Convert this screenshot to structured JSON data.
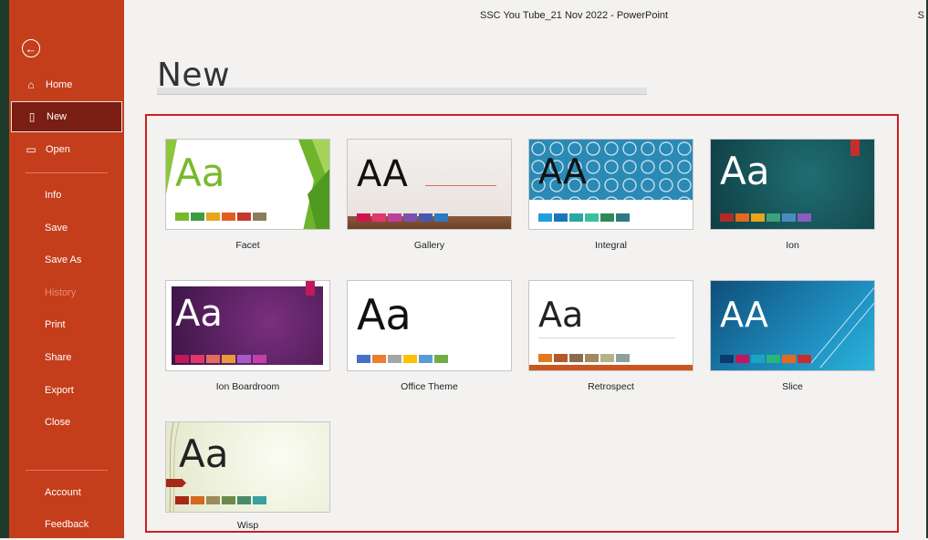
{
  "window": {
    "doc_title": "SSC You Tube_21 Nov 2022  -  PowerPoint",
    "user_initial": "S"
  },
  "sidebar": {
    "back_icon": "←",
    "items": [
      {
        "label": "Home",
        "icon": "home-icon"
      },
      {
        "label": "New",
        "icon": "new-document-icon"
      },
      {
        "label": "Open",
        "icon": "folder-open-icon"
      },
      {
        "label": "Info"
      },
      {
        "label": "Save"
      },
      {
        "label": "Save As"
      },
      {
        "label": "History"
      },
      {
        "label": "Print"
      },
      {
        "label": "Share"
      },
      {
        "label": "Export"
      },
      {
        "label": "Close"
      },
      {
        "label": "Account"
      },
      {
        "label": "Feedback"
      }
    ]
  },
  "page": {
    "title": "New"
  },
  "templates": [
    {
      "name": "Facet",
      "sample": "Aa"
    },
    {
      "name": "Gallery",
      "sample": "AA"
    },
    {
      "name": "Integral",
      "sample": "AA"
    },
    {
      "name": "Ion",
      "sample": "Aa"
    },
    {
      "name": "Ion Boardroom",
      "sample": "Aa"
    },
    {
      "name": "Office Theme",
      "sample": "Aa"
    },
    {
      "name": "Retrospect",
      "sample": "Aa"
    },
    {
      "name": "Slice",
      "sample": "AA"
    },
    {
      "name": "Wisp",
      "sample": "Aa"
    }
  ],
  "colors": {
    "sidebar": "#c43e1c",
    "selected_nav": "#7a1d12",
    "highlight_border": "#d31c1c"
  }
}
